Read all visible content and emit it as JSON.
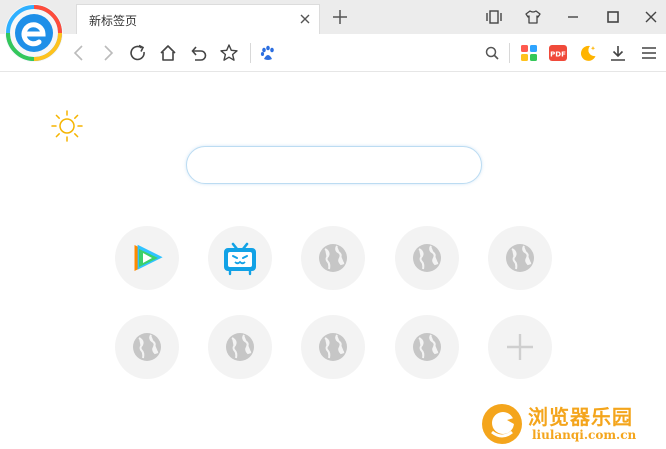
{
  "tab": {
    "title": "新标签页"
  },
  "search": {
    "placeholder": ""
  },
  "toolbar": {
    "icons": [
      "back-icon",
      "forward-icon",
      "refresh-icon",
      "home-icon",
      "undo-icon",
      "star-icon",
      "baidu-paw-icon",
      "search-icon",
      "apps-icon",
      "pdf-icon",
      "night-mode-icon",
      "download-icon",
      "menu-icon"
    ],
    "pdf_label": "PDF"
  },
  "window_controls": [
    "mini-mode-icon",
    "skin-icon",
    "minimize-icon",
    "maximize-icon",
    "close-icon"
  ],
  "speed_dial": [
    {
      "name": "tencent-video",
      "icon": "tencent-video-icon"
    },
    {
      "name": "bilibili",
      "icon": "bilibili-icon"
    },
    {
      "name": "empty-1",
      "icon": "globe-icon"
    },
    {
      "name": "empty-2",
      "icon": "globe-icon"
    },
    {
      "name": "empty-3",
      "icon": "globe-icon"
    },
    {
      "name": "empty-4",
      "icon": "globe-icon"
    },
    {
      "name": "empty-5",
      "icon": "globe-icon"
    },
    {
      "name": "empty-6",
      "icon": "globe-icon"
    },
    {
      "name": "empty-7",
      "icon": "globe-icon"
    },
    {
      "name": "add",
      "icon": "plus-icon"
    }
  ],
  "watermark": {
    "title": "浏览器乐园",
    "url": "liulanqi.com.cn"
  },
  "colors": {
    "accent": "#1aa0e6",
    "weather": "#f5b400",
    "watermark": "#f4a51c",
    "tile_bg": "#f3f3f3",
    "globe": "#c6c6c6"
  }
}
